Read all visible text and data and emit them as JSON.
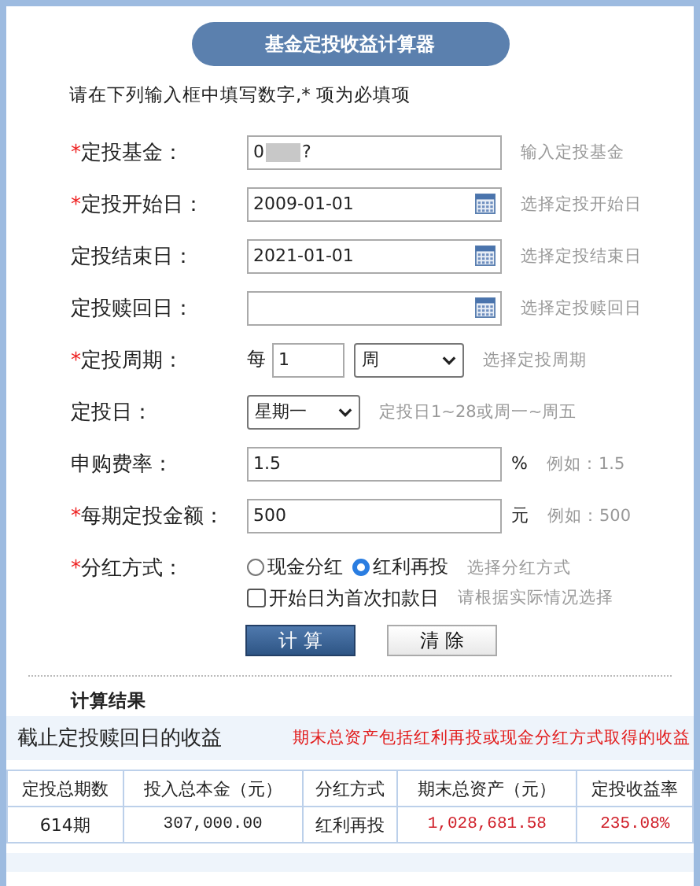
{
  "title": "基金定投收益计算器",
  "instruction": "请在下列输入框中填写数字,* 项为必填项",
  "form_rows": [
    {
      "kind": "redacted",
      "mark": "*",
      "label": "定投基金：",
      "value_start": "0",
      "value_end": "?",
      "hint": "输入定投基金"
    },
    {
      "kind": "date",
      "mark": "*",
      "label": "定投开始日：",
      "value": "2009-01-01",
      "hint": "选择定投开始日"
    },
    {
      "kind": "date",
      "label": "定投结束日：",
      "value": "2021-01-01",
      "hint": "选择定投结束日"
    },
    {
      "kind": "date",
      "label": "定投赎回日：",
      "hint": "选择定投赎回日"
    },
    {
      "kind": "period",
      "mark": "*",
      "label": "定投周期：",
      "prefix": "每",
      "value": "1",
      "unit": "周",
      "hint": "选择定投周期"
    },
    {
      "kind": "weekday",
      "label": "定投日：",
      "value": "星期一",
      "hint": "定投日1~28或周一~周五"
    },
    {
      "kind": "text",
      "label": "申购费率：",
      "value": "1.5",
      "suffix": "%",
      "hint": "例如：1.5"
    },
    {
      "kind": "text",
      "mark": "*",
      "label": "每期定投金额：",
      "value": "500",
      "suffix": "元",
      "hint": "例如：500"
    },
    {
      "kind": "radio",
      "mark": "*",
      "label": "分红方式：",
      "options": [
        {
          "label": "现金分红",
          "selected": false
        },
        {
          "label": "红利再投",
          "selected": true
        }
      ],
      "hint": "选择分红方式"
    },
    {
      "kind": "checkbox",
      "label": "开始日为首次扣款日",
      "checked": false,
      "hint": "请根据实际情况选择"
    }
  ],
  "buttons": [
    {
      "label": "计 算",
      "kind": "primary"
    },
    {
      "label": "清 除",
      "kind": "secondary"
    }
  ],
  "result": {
    "heading": "计算结果",
    "subtitle": "截止定投赎回日的收益",
    "note": "期末总资产包括红利再投或现金分红方式取得的收益",
    "columns": [
      "定投总期数",
      "投入总本金（元）",
      "分红方式",
      "期末总资产（元）",
      "定投收益率"
    ],
    "rows": [
      {
        "cells": [
          {
            "text": "614期",
            "red": false
          },
          {
            "text": "307,000.00",
            "red": false
          },
          {
            "text": "红利再投",
            "red": false
          },
          {
            "text": "1,028,681.58",
            "red": true
          },
          {
            "text": "235.08%",
            "red": true
          }
        ]
      }
    ]
  }
}
